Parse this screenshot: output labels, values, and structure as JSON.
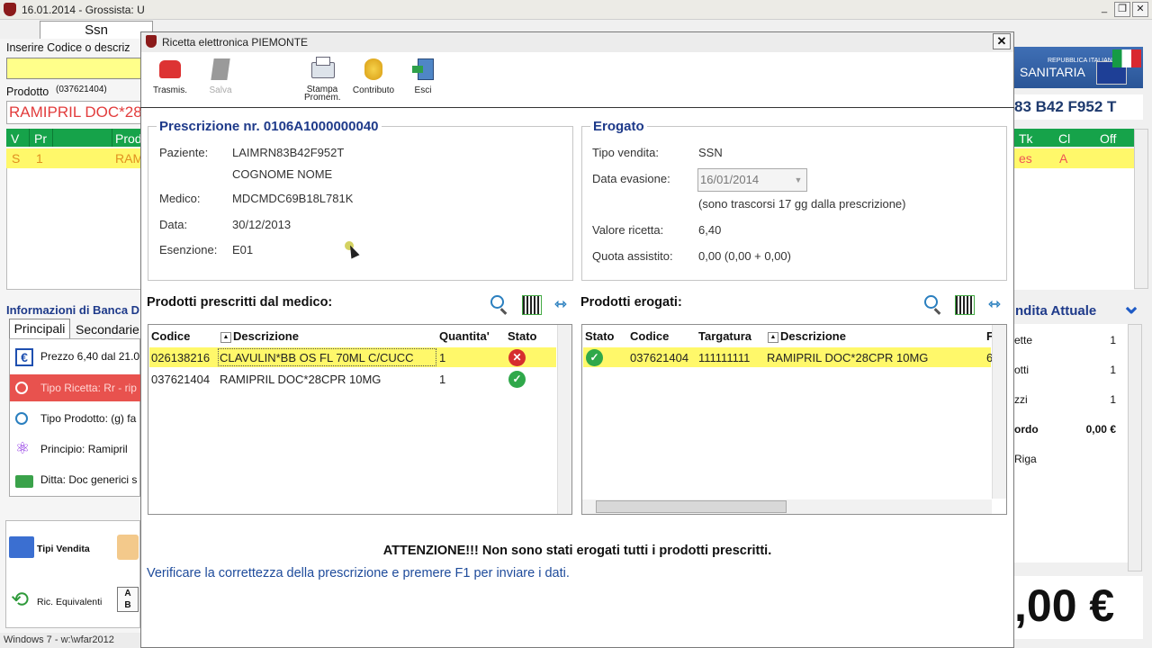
{
  "main": {
    "title": "16.01.2014 - Grossista: U",
    "tab": "Ssn",
    "code_label": "Inserire Codice o descriz",
    "product_label": "Prodotto",
    "product_code": "(037621404)",
    "product_name": "RAMIPRIL DOC*28",
    "grid_headers": [
      "V",
      "Pr",
      "Prod"
    ],
    "grid_row": [
      "S",
      "1",
      "RAM"
    ],
    "info_title": "Informazioni di Banca D",
    "tabs": [
      "Principali",
      "Secondarie"
    ],
    "info_items": [
      "Prezzo 6,40 dal 21.0",
      "Tipo Ricetta: Rr - rip",
      "Tipo Prodotto: (g) fa",
      "Principio: Ramipril",
      "Ditta: Doc generici s"
    ],
    "buttons": [
      "Tipi Vendita",
      "Ric. Equivalenti"
    ],
    "status": "Windows 7 - w:\\wfar2012"
  },
  "right": {
    "banner_top": "REPUBBLICA ITALIANA",
    "banner": "SANITARIA",
    "cf": "83  B42  F952  T",
    "grid_headers": [
      "Tk",
      "Cl",
      "Off"
    ],
    "grid_row": [
      "es",
      "A"
    ],
    "vendita_title": "ndita Attuale",
    "rows": [
      {
        "label": "ette",
        "value": "1"
      },
      {
        "label": "otti",
        "value": "1"
      },
      {
        "label": "zzi",
        "value": "1"
      },
      {
        "label": "ordo",
        "value": "0,00 €"
      },
      {
        "label": "Riga",
        "value": ""
      }
    ],
    "total": ",00 €"
  },
  "dialog": {
    "title": "Ricetta elettronica PIEMONTE",
    "toolbar": [
      "Trasmis.",
      "Salva",
      "Stampa Promem.",
      "Contributo",
      "Esci"
    ],
    "prescrizione": {
      "title": "Prescrizione nr. 0106A1000000040",
      "labels": [
        "Paziente:",
        "Medico:",
        "Data:",
        "Esenzione:"
      ],
      "paziente_cf": "LAIMRN83B42F952T",
      "paziente_nome": "COGNOME NOME",
      "medico": "MDCMDC69B18L781K",
      "data": "30/12/2013",
      "esenzione": "E01"
    },
    "erogato": {
      "title": "Erogato",
      "labels": [
        "Tipo vendita:",
        "Data evasione:",
        "Valore ricetta:",
        "Quota assistito:"
      ],
      "tipo_vendita": "SSN",
      "data_evasione": "16/01/2014",
      "note": "(sono trascorsi 17 gg dalla prescrizione)",
      "valore": "6,40",
      "quota": "0,00 (0,00 + 0,00)"
    },
    "prescritti": {
      "title": "Prodotti prescritti dal medico:",
      "headers": [
        "Codice",
        "Descrizione",
        "Quantita'",
        "Stato"
      ],
      "rows": [
        {
          "codice": "026138216",
          "descrizione": "CLAVULIN*BB OS FL 70ML C/CUCC",
          "quantita": "1",
          "stato": "error"
        },
        {
          "codice": "037621404",
          "descrizione": "RAMIPRIL DOC*28CPR 10MG",
          "quantita": "1",
          "stato": "ok"
        }
      ]
    },
    "erogati": {
      "title": "Prodotti erogati:",
      "headers": [
        "Stato",
        "Codice",
        "Targatura",
        "Descrizione",
        "F"
      ],
      "rows": [
        {
          "stato": "ok",
          "codice": "037621404",
          "targatura": "111111111",
          "descrizione": "RAMIPRIL DOC*28CPR 10MG",
          "extra": "6"
        }
      ]
    },
    "warning": "ATTENZIONE!!! Non sono stati erogati tutti  i prodotti prescritti.",
    "instruction": "Verificare la correttezza della prescrizione e premere F1 per inviare i dati."
  }
}
